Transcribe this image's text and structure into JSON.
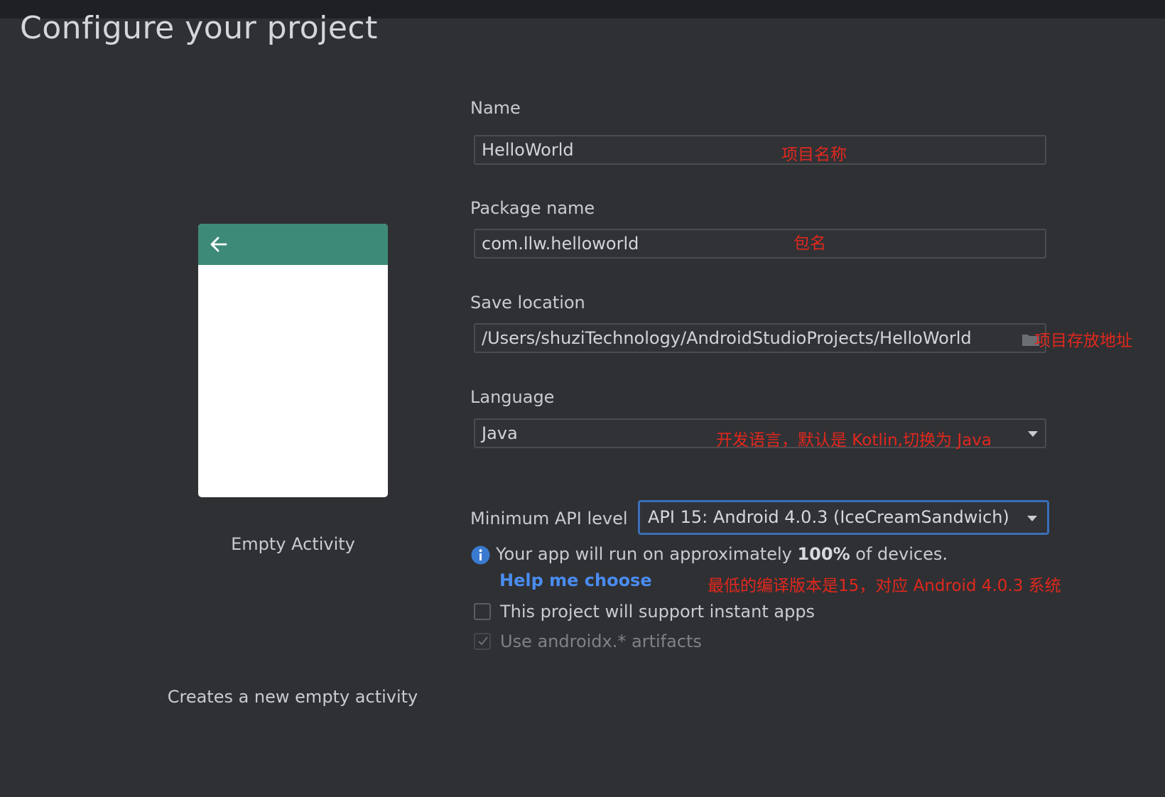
{
  "header": {
    "title": "Configure your project"
  },
  "template": {
    "name": "Empty Activity",
    "description": "Creates a new empty activity"
  },
  "form": {
    "name": {
      "label": "Name",
      "value": "HelloWorld",
      "annotation": "项目名称"
    },
    "package": {
      "label": "Package name",
      "value": "com.llw.helloworld",
      "annotation": "包名"
    },
    "save_location": {
      "label": "Save location",
      "value": "/Users/shuziTechnology/AndroidStudioProjects/HelloWorld",
      "annotation": "项目存放地址"
    },
    "language": {
      "label": "Language",
      "value": "Java",
      "annotation": "开发语言，默认是 Kotlin,切换为 Java"
    },
    "min_api": {
      "label": "Minimum API level",
      "value": "API 15: Android 4.0.3 (IceCreamSandwich)",
      "info_prefix": "Your app will run on approximately ",
      "info_bold": "100%",
      "info_suffix": " of devices.",
      "help_link": "Help me choose",
      "annotation": "最低的编译版本是15，对应 Android 4.0.3 系统"
    },
    "instant_apps": {
      "label": "This project will support instant apps",
      "checked": false
    },
    "androidx": {
      "label": "Use androidx.* artifacts",
      "checked": true,
      "enabled": false
    }
  },
  "colors": {
    "background": "#2f3033",
    "accent_green": "#3e8a78",
    "link_blue": "#4a8cf0",
    "annotation_red": "#e0281d",
    "focus_border": "#3a6fb8"
  }
}
